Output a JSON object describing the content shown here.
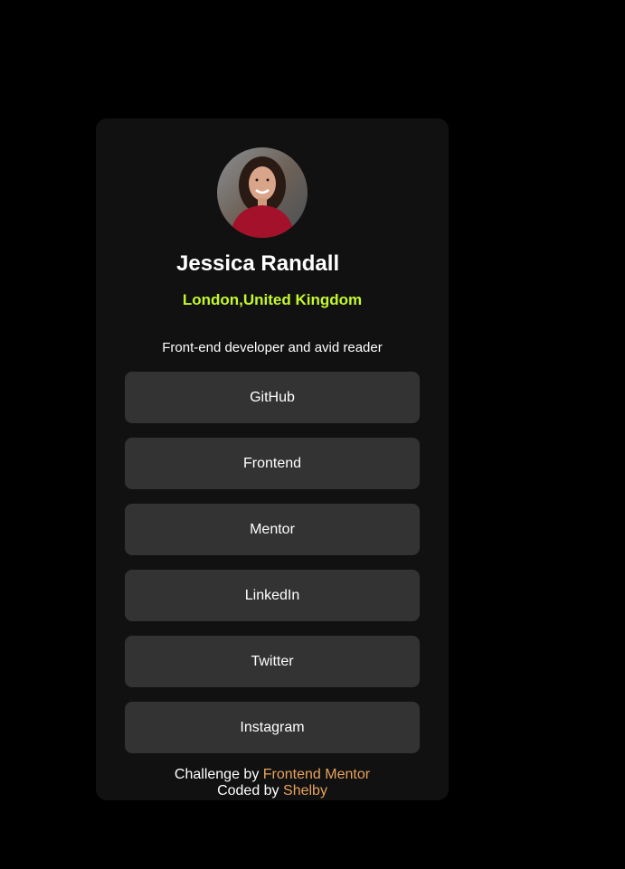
{
  "profile": {
    "name": "Jessica Randall",
    "location": "London,United Kingdom",
    "bio": "Front-end developer and avid reader"
  },
  "links": [
    {
      "label": "GitHub"
    },
    {
      "label": "Frontend"
    },
    {
      "label": "Mentor"
    },
    {
      "label": "LinkedIn"
    },
    {
      "label": "Twitter"
    },
    {
      "label": "Instagram"
    }
  ],
  "footer": {
    "challenge_prefix": "Challenge by",
    "challenge_link": "Frontend Mentor",
    "coded_prefix": "Coded by",
    "coded_link": "Shelby"
  },
  "colors": {
    "background": "#000000",
    "card": "#111111",
    "button": "#333333",
    "accent_green": "#c4f82a",
    "accent_orange": "#e7a25b"
  }
}
